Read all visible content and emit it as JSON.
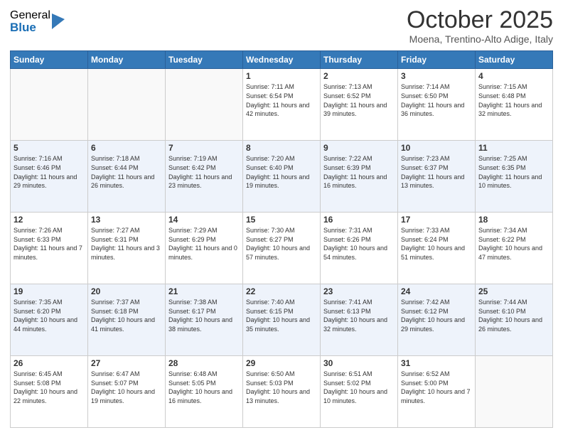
{
  "header": {
    "logo": {
      "general": "General",
      "blue": "Blue"
    },
    "title": "October 2025",
    "location": "Moena, Trentino-Alto Adige, Italy"
  },
  "weekdays": [
    "Sunday",
    "Monday",
    "Tuesday",
    "Wednesday",
    "Thursday",
    "Friday",
    "Saturday"
  ],
  "weeks": [
    [
      {
        "day": "",
        "sunrise": "",
        "sunset": "",
        "daylight": ""
      },
      {
        "day": "",
        "sunrise": "",
        "sunset": "",
        "daylight": ""
      },
      {
        "day": "",
        "sunrise": "",
        "sunset": "",
        "daylight": ""
      },
      {
        "day": "1",
        "sunrise": "7:11 AM",
        "sunset": "6:54 PM",
        "daylight": "11 hours and 42 minutes."
      },
      {
        "day": "2",
        "sunrise": "7:13 AM",
        "sunset": "6:52 PM",
        "daylight": "11 hours and 39 minutes."
      },
      {
        "day": "3",
        "sunrise": "7:14 AM",
        "sunset": "6:50 PM",
        "daylight": "11 hours and 36 minutes."
      },
      {
        "day": "4",
        "sunrise": "7:15 AM",
        "sunset": "6:48 PM",
        "daylight": "11 hours and 32 minutes."
      }
    ],
    [
      {
        "day": "5",
        "sunrise": "7:16 AM",
        "sunset": "6:46 PM",
        "daylight": "11 hours and 29 minutes."
      },
      {
        "day": "6",
        "sunrise": "7:18 AM",
        "sunset": "6:44 PM",
        "daylight": "11 hours and 26 minutes."
      },
      {
        "day": "7",
        "sunrise": "7:19 AM",
        "sunset": "6:42 PM",
        "daylight": "11 hours and 23 minutes."
      },
      {
        "day": "8",
        "sunrise": "7:20 AM",
        "sunset": "6:40 PM",
        "daylight": "11 hours and 19 minutes."
      },
      {
        "day": "9",
        "sunrise": "7:22 AM",
        "sunset": "6:39 PM",
        "daylight": "11 hours and 16 minutes."
      },
      {
        "day": "10",
        "sunrise": "7:23 AM",
        "sunset": "6:37 PM",
        "daylight": "11 hours and 13 minutes."
      },
      {
        "day": "11",
        "sunrise": "7:25 AM",
        "sunset": "6:35 PM",
        "daylight": "11 hours and 10 minutes."
      }
    ],
    [
      {
        "day": "12",
        "sunrise": "7:26 AM",
        "sunset": "6:33 PM",
        "daylight": "11 hours and 7 minutes."
      },
      {
        "day": "13",
        "sunrise": "7:27 AM",
        "sunset": "6:31 PM",
        "daylight": "11 hours and 3 minutes."
      },
      {
        "day": "14",
        "sunrise": "7:29 AM",
        "sunset": "6:29 PM",
        "daylight": "11 hours and 0 minutes."
      },
      {
        "day": "15",
        "sunrise": "7:30 AM",
        "sunset": "6:27 PM",
        "daylight": "10 hours and 57 minutes."
      },
      {
        "day": "16",
        "sunrise": "7:31 AM",
        "sunset": "6:26 PM",
        "daylight": "10 hours and 54 minutes."
      },
      {
        "day": "17",
        "sunrise": "7:33 AM",
        "sunset": "6:24 PM",
        "daylight": "10 hours and 51 minutes."
      },
      {
        "day": "18",
        "sunrise": "7:34 AM",
        "sunset": "6:22 PM",
        "daylight": "10 hours and 47 minutes."
      }
    ],
    [
      {
        "day": "19",
        "sunrise": "7:35 AM",
        "sunset": "6:20 PM",
        "daylight": "10 hours and 44 minutes."
      },
      {
        "day": "20",
        "sunrise": "7:37 AM",
        "sunset": "6:18 PM",
        "daylight": "10 hours and 41 minutes."
      },
      {
        "day": "21",
        "sunrise": "7:38 AM",
        "sunset": "6:17 PM",
        "daylight": "10 hours and 38 minutes."
      },
      {
        "day": "22",
        "sunrise": "7:40 AM",
        "sunset": "6:15 PM",
        "daylight": "10 hours and 35 minutes."
      },
      {
        "day": "23",
        "sunrise": "7:41 AM",
        "sunset": "6:13 PM",
        "daylight": "10 hours and 32 minutes."
      },
      {
        "day": "24",
        "sunrise": "7:42 AM",
        "sunset": "6:12 PM",
        "daylight": "10 hours and 29 minutes."
      },
      {
        "day": "25",
        "sunrise": "7:44 AM",
        "sunset": "6:10 PM",
        "daylight": "10 hours and 26 minutes."
      }
    ],
    [
      {
        "day": "26",
        "sunrise": "6:45 AM",
        "sunset": "5:08 PM",
        "daylight": "10 hours and 22 minutes."
      },
      {
        "day": "27",
        "sunrise": "6:47 AM",
        "sunset": "5:07 PM",
        "daylight": "10 hours and 19 minutes."
      },
      {
        "day": "28",
        "sunrise": "6:48 AM",
        "sunset": "5:05 PM",
        "daylight": "10 hours and 16 minutes."
      },
      {
        "day": "29",
        "sunrise": "6:50 AM",
        "sunset": "5:03 PM",
        "daylight": "10 hours and 13 minutes."
      },
      {
        "day": "30",
        "sunrise": "6:51 AM",
        "sunset": "5:02 PM",
        "daylight": "10 hours and 10 minutes."
      },
      {
        "day": "31",
        "sunrise": "6:52 AM",
        "sunset": "5:00 PM",
        "daylight": "10 hours and 7 minutes."
      },
      {
        "day": "",
        "sunrise": "",
        "sunset": "",
        "daylight": ""
      }
    ]
  ]
}
